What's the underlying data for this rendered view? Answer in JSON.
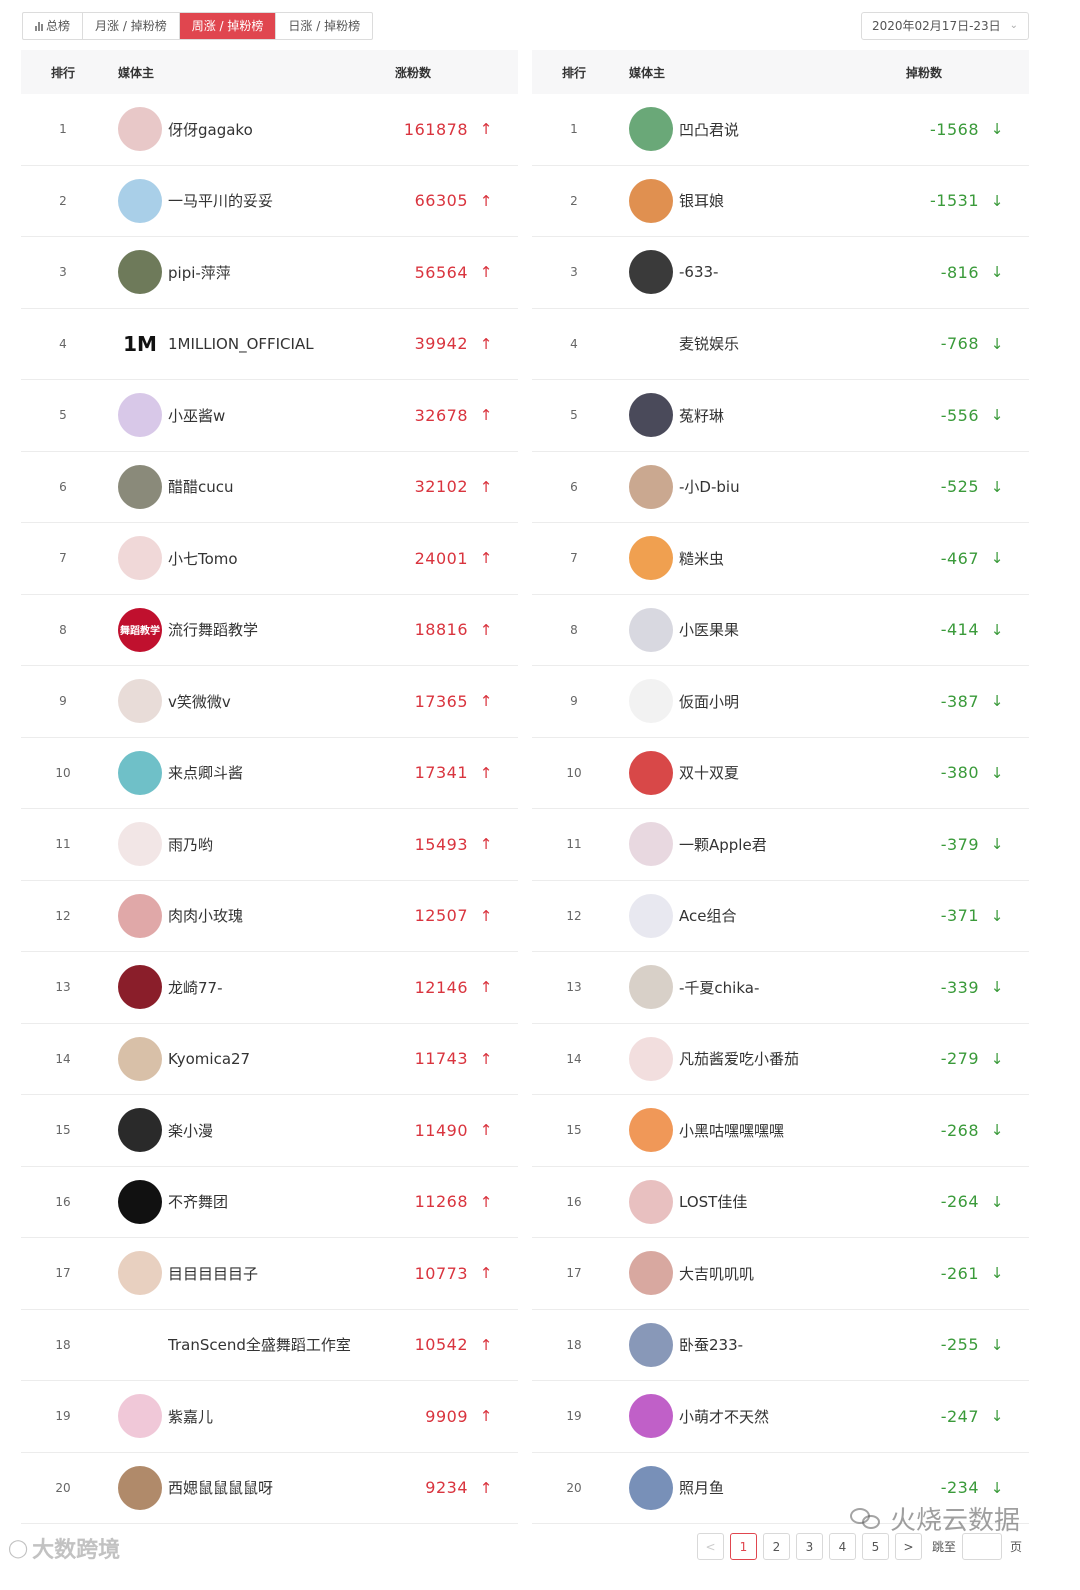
{
  "tabs": [
    {
      "label": "总榜",
      "icon": "bar-chart-icon",
      "active": false
    },
    {
      "label": "月涨 / 掉粉榜",
      "active": false
    },
    {
      "label": "周涨 / 掉粉榜",
      "active": true
    },
    {
      "label": "日涨 / 掉粉榜",
      "active": false
    }
  ],
  "date_range": "2020年02月17日-23日",
  "left_table": {
    "headers": {
      "rank": "排行",
      "name": "媒体主",
      "count": "涨粉数"
    },
    "rows": [
      {
        "rank": "1",
        "name": "伢伢gagako",
        "count": "161878"
      },
      {
        "rank": "2",
        "name": "一马平川的妥妥",
        "count": "66305"
      },
      {
        "rank": "3",
        "name": "pipi-萍萍",
        "count": "56564"
      },
      {
        "rank": "4",
        "name": "1MILLION_OFFICIAL",
        "count": "39942",
        "logo_text": "1M"
      },
      {
        "rank": "5",
        "name": "小巫酱w",
        "count": "32678"
      },
      {
        "rank": "6",
        "name": "醋醋cucu",
        "count": "32102"
      },
      {
        "rank": "7",
        "name": "小七Tomo",
        "count": "24001"
      },
      {
        "rank": "8",
        "name": "流行舞蹈教学",
        "count": "18816",
        "logo_text": "舞蹈教学"
      },
      {
        "rank": "9",
        "name": "v笑微微v",
        "count": "17365"
      },
      {
        "rank": "10",
        "name": "来点卿斗酱",
        "count": "17341"
      },
      {
        "rank": "11",
        "name": "雨乃哟",
        "count": "15493"
      },
      {
        "rank": "12",
        "name": "肉肉小玫瑰",
        "count": "12507"
      },
      {
        "rank": "13",
        "name": "龙崎77-",
        "count": "12146"
      },
      {
        "rank": "14",
        "name": "Kyomica27",
        "count": "11743"
      },
      {
        "rank": "15",
        "name": "楽小漫",
        "count": "11490"
      },
      {
        "rank": "16",
        "name": "不齐舞团",
        "count": "11268"
      },
      {
        "rank": "17",
        "name": "目目目目目子",
        "count": "10773"
      },
      {
        "rank": "18",
        "name": "TranScend全盛舞蹈工作室",
        "count": "10542"
      },
      {
        "rank": "19",
        "name": "紫嘉儿",
        "count": "9909"
      },
      {
        "rank": "20",
        "name": "西媤鼠鼠鼠鼠呀",
        "count": "9234"
      }
    ]
  },
  "right_table": {
    "headers": {
      "rank": "排行",
      "name": "媒体主",
      "count": "掉粉数"
    },
    "rows": [
      {
        "rank": "1",
        "name": "凹凸君说",
        "count": "-1568"
      },
      {
        "rank": "2",
        "name": "银耳娘",
        "count": "-1531"
      },
      {
        "rank": "3",
        "name": "-633-",
        "count": "-816"
      },
      {
        "rank": "4",
        "name": "麦锐娱乐",
        "count": "-768"
      },
      {
        "rank": "5",
        "name": "菟籽琳",
        "count": "-556"
      },
      {
        "rank": "6",
        "name": "-小D-biu",
        "count": "-525"
      },
      {
        "rank": "7",
        "name": "糙米虫",
        "count": "-467"
      },
      {
        "rank": "8",
        "name": "小医果果",
        "count": "-414"
      },
      {
        "rank": "9",
        "name": "仮面小明",
        "count": "-387"
      },
      {
        "rank": "10",
        "name": "双十双夏",
        "count": "-380"
      },
      {
        "rank": "11",
        "name": "一颗Apple君",
        "count": "-379"
      },
      {
        "rank": "12",
        "name": "Ace组合",
        "count": "-371"
      },
      {
        "rank": "13",
        "name": "-千夏chika-",
        "count": "-339"
      },
      {
        "rank": "14",
        "name": "凡茄酱爱吃小番茄",
        "count": "-279"
      },
      {
        "rank": "15",
        "name": "小黑咕嘿嘿嘿嘿",
        "count": "-268"
      },
      {
        "rank": "16",
        "name": "LOST佳佳",
        "count": "-264"
      },
      {
        "rank": "17",
        "name": "大吉叽叽叽",
        "count": "-261"
      },
      {
        "rank": "18",
        "name": "卧蚕233-",
        "count": "-255"
      },
      {
        "rank": "19",
        "name": "小萌才不天然",
        "count": "-247"
      },
      {
        "rank": "20",
        "name": "照月鱼",
        "count": "-234"
      }
    ]
  },
  "pagination": {
    "prev": "<",
    "pages": [
      "1",
      "2",
      "3",
      "4",
      "5"
    ],
    "current": "1",
    "next": ">",
    "jump_label": "跳至",
    "page_label": "页"
  },
  "watermarks": {
    "right": "火烧云数据",
    "left": "大数跨境"
  },
  "colors": {
    "accent": "#e0464f",
    "up": "#d9343e",
    "down": "#3a9a3a"
  }
}
